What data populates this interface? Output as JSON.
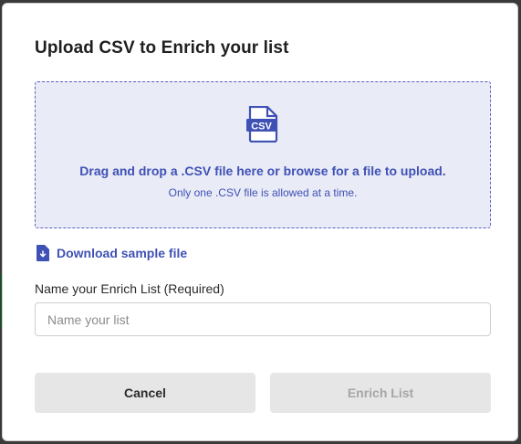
{
  "modal": {
    "title": "Upload CSV to Enrich your list"
  },
  "dropzone": {
    "icon": "csv-file-icon",
    "icon_text": "CSV",
    "main_text": "Drag and drop a .CSV file here or browse for a file to upload.",
    "sub_text": "Only one .CSV file is allowed at a time."
  },
  "download": {
    "icon": "download-file-icon",
    "label": "Download sample file"
  },
  "name_field": {
    "label": "Name your Enrich List (Required)",
    "placeholder": "Name your list",
    "value": ""
  },
  "buttons": {
    "cancel_label": "Cancel",
    "enrich_label": "Enrich List",
    "enrich_disabled": true
  },
  "colors": {
    "accent": "#3f51b5",
    "dropzone_bg": "#e9ebf6",
    "dropzone_border": "#5b5fc7",
    "button_bg": "#e6e6e6",
    "disabled_text": "#a6a6a6"
  }
}
